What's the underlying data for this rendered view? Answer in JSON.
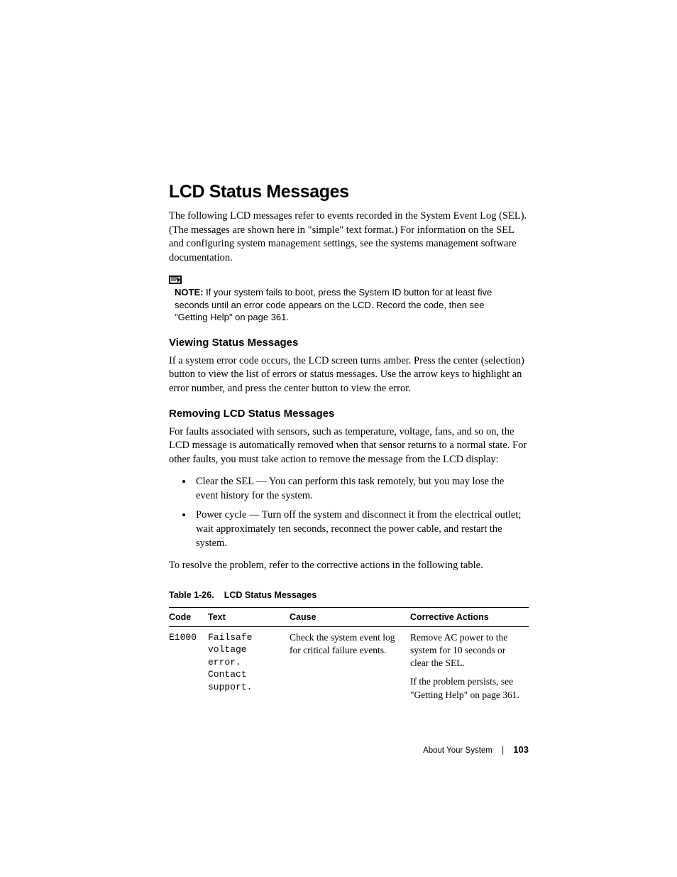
{
  "heading": "LCD Status Messages",
  "intro": "The following LCD messages refer to events recorded in the System Event Log (SEL). (The messages are shown here in \"simple\" text format.) For information on the SEL and configuring system management settings, see the systems management software documentation.",
  "note_label": "NOTE:",
  "note_body": " If your system fails to boot, press the System ID button for at least five seconds until an error code appears on the LCD. Record the code, then see \"Getting Help\" on page 361.",
  "h2a": "Viewing Status Messages",
  "para_a": "If a system error code occurs, the LCD screen turns amber. Press the center (selection) button to view the list of errors or status messages. Use the arrow keys to highlight an error number, and press the center button to view the error.",
  "h2b": "Removing LCD Status Messages",
  "para_b": "For faults associated with sensors, such as temperature, voltage, fans, and so on, the LCD message is automatically removed when that sensor returns to a normal state. For other faults, you must take action to remove the message from the LCD display:",
  "bullets": [
    "Clear the SEL — You can perform this task remotely, but you may lose the event history for the system.",
    "Power cycle — Turn off the system and disconnect it from the electrical outlet; wait approximately ten seconds, reconnect the power cable, and restart the system."
  ],
  "para_c": "To resolve the problem, refer to the corrective actions in the following table.",
  "table_caption_ref": "Table 1-26.",
  "table_caption_title": "LCD Status Messages",
  "thead": {
    "code": "Code",
    "text": "Text",
    "cause": "Cause",
    "actions": "Corrective Actions"
  },
  "row": {
    "code": "E1000",
    "text_lines": [
      "Failsafe",
      "voltage",
      "error.",
      "Contact",
      "support."
    ],
    "cause": "Check the system event log for critical failure events.",
    "action1": "Remove AC power to the system for 10 seconds or clear the SEL.",
    "action2": "If the problem persists, see \"Getting Help\" on page 361."
  },
  "footer_section": "About Your System",
  "footer_page": "103"
}
